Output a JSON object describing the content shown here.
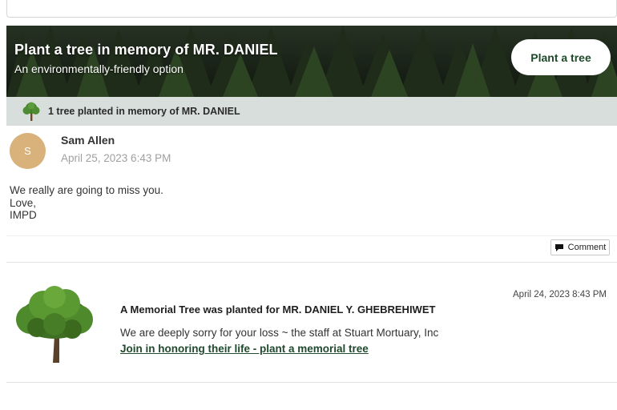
{
  "banner": {
    "title": "Plant a tree in memory of MR. DANIEL",
    "subtitle": "An environmentally-friendly option",
    "button_label": "Plant a tree"
  },
  "planted_bar": {
    "text": "1 tree planted in memory of MR. DANIEL",
    "icon": "tree-icon"
  },
  "post": {
    "avatar_initial": "S",
    "author": "Sam Allen",
    "date": "April 25, 2023 6:43 PM",
    "message_lines": [
      "We really are going to miss you.",
      "Love,",
      "IMPD"
    ],
    "comment_label": "Comment",
    "comment_icon": "speech-bubble-icon"
  },
  "memorial": {
    "date": "April 24, 2023 8:43 PM",
    "heading": "A Memorial Tree was planted for MR. DANIEL Y. GHEBREHIWET",
    "message": "We are deeply sorry for your loss ~ the staff at Stuart Mortuary, Inc",
    "link": "Join in honoring their life - plant a memorial tree",
    "icon": "memorial-tree-icon"
  },
  "colors": {
    "banner_bg": "#1f2a1d",
    "planted_bar_bg": "#d8dedb",
    "avatar_bg": "#d8b27a",
    "button_text": "#1d4a2a",
    "link": "#1f4a2c"
  }
}
